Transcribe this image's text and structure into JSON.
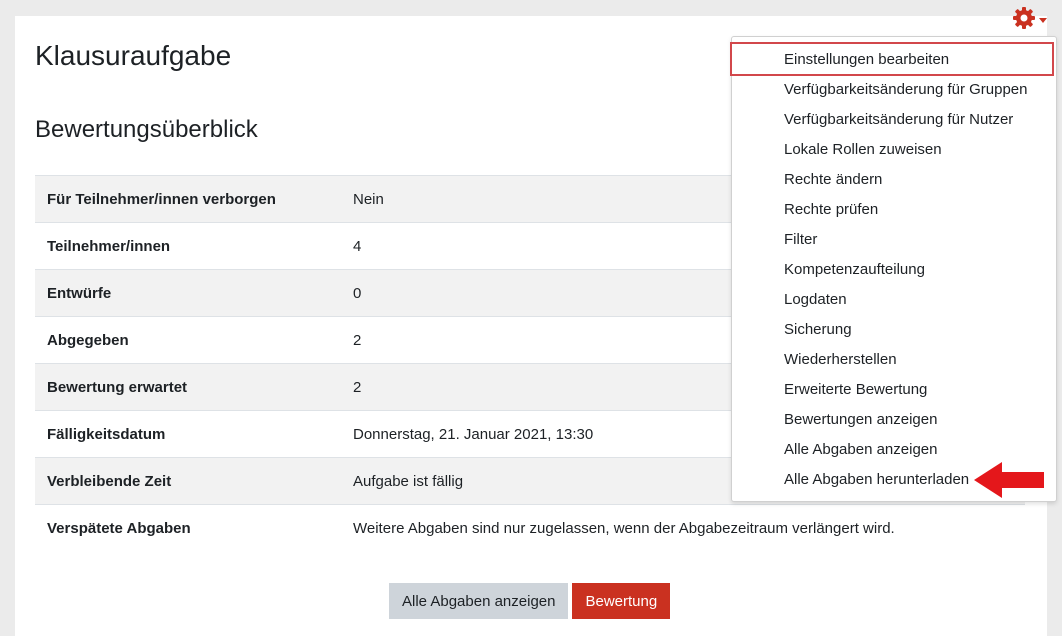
{
  "header": {
    "title": "Klausuraufgabe"
  },
  "section": {
    "title": "Bewertungsüberblick"
  },
  "summary": [
    {
      "label": "Für Teilnehmer/innen verborgen",
      "value": "Nein"
    },
    {
      "label": "Teilnehmer/innen",
      "value": "4"
    },
    {
      "label": "Entwürfe",
      "value": "0"
    },
    {
      "label": "Abgegeben",
      "value": "2"
    },
    {
      "label": "Bewertung erwartet",
      "value": "2"
    },
    {
      "label": "Fälligkeitsdatum",
      "value": "Donnerstag, 21. Januar 2021, 13:30"
    },
    {
      "label": "Verbleibende Zeit",
      "value": "Aufgabe ist fällig"
    },
    {
      "label": "Verspätete Abgaben",
      "value": "Weitere Abgaben sind nur zugelassen, wenn der Abgabezeitraum verlängert wird."
    }
  ],
  "buttons": {
    "view_all": "Alle Abgaben anzeigen",
    "grade": "Bewertung"
  },
  "menu": {
    "items": [
      "Einstellungen bearbeiten",
      "Verfügbarkeitsänderung für Gruppen",
      "Verfügbarkeitsänderung für Nutzer",
      "Lokale Rollen zuweisen",
      "Rechte ändern",
      "Rechte prüfen",
      "Filter",
      "Kompetenzaufteilung",
      "Logdaten",
      "Sicherung",
      "Wiederherstellen",
      "Erweiterte Bewertung",
      "Bewertungen anzeigen",
      "Alle Abgaben anzeigen",
      "Alle Abgaben herunterladen"
    ]
  },
  "icons": {
    "settings": "gear-icon",
    "caret": "caret-down-icon",
    "annotation": "arrow-left-icon"
  },
  "colors": {
    "accent": "#ca3120",
    "highlight": "#d2474b"
  }
}
